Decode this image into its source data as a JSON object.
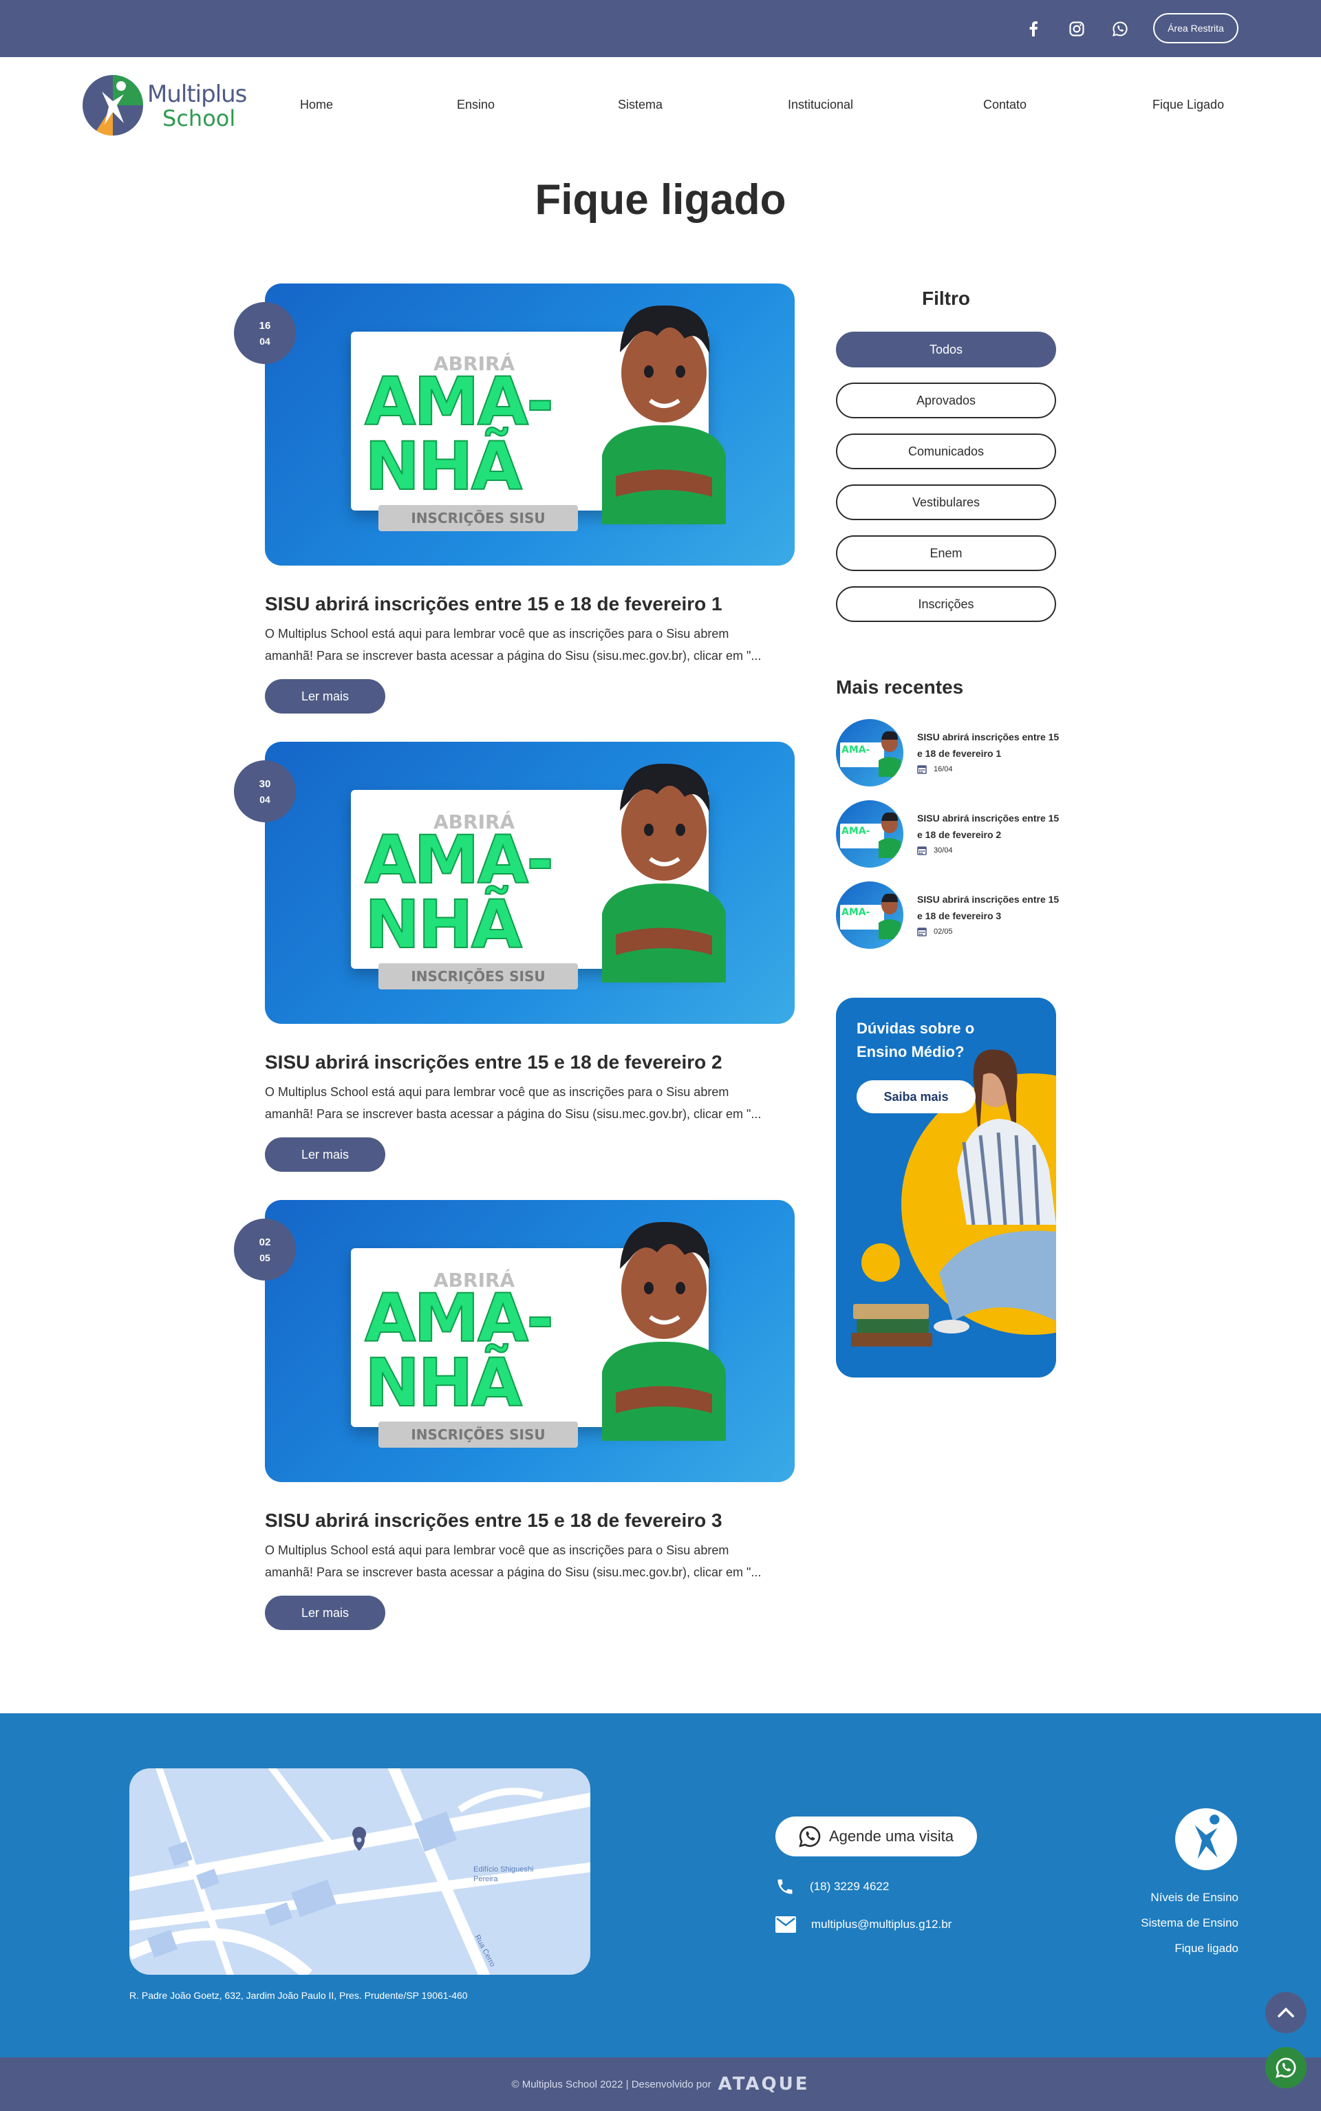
{
  "topbar": {
    "area_label": "Área Restrita",
    "icons": [
      "facebook-icon",
      "instagram-icon",
      "whatsapp-icon"
    ]
  },
  "brand": {
    "line1": "Multiplus",
    "line2": "School"
  },
  "nav": {
    "items": [
      {
        "label": "Home"
      },
      {
        "label": "Ensino"
      },
      {
        "label": "Sistema"
      },
      {
        "label": "Institucional"
      },
      {
        "label": "Contato"
      },
      {
        "label": "Fique Ligado"
      }
    ]
  },
  "page": {
    "title": "Fique ligado"
  },
  "banner_art": {
    "line_top": "ABRIRÁ",
    "line_1": "AMA-",
    "line_2": "NHÃ",
    "tag": "INSCRIÇÕES SISU"
  },
  "posts": [
    {
      "day": "16",
      "month": "04",
      "title": "SISU abrirá inscrições entre 15 e 18 de fevereiro 1",
      "excerpt": "O Multiplus School está aqui para lembrar você que as inscrições para o Sisu abrem amanhã! Para se inscrever basta acessar a página do Sisu (sisu.mec.gov.br), clicar em \"...",
      "more_label": "Ler mais"
    },
    {
      "day": "30",
      "month": "04",
      "title": "SISU abrirá inscrições entre 15 e 18 de fevereiro 2",
      "excerpt": "O Multiplus School está aqui para lembrar você que as inscrições para o Sisu abrem amanhã! Para se inscrever basta acessar a página do Sisu (sisu.mec.gov.br), clicar em \"...",
      "more_label": "Ler mais"
    },
    {
      "day": "02",
      "month": "05",
      "title": "SISU abrirá inscrições entre 15 e 18 de fevereiro 3",
      "excerpt": "O Multiplus School está aqui para lembrar você que as inscrições para o Sisu abrem amanhã! Para se inscrever basta acessar a página do Sisu (sisu.mec.gov.br), clicar em \"...",
      "more_label": "Ler mais"
    }
  ],
  "sidebar": {
    "filter_title": "Filtro",
    "filters": [
      {
        "label": "Todos",
        "active": true
      },
      {
        "label": "Aprovados",
        "active": false
      },
      {
        "label": "Comunicados",
        "active": false
      },
      {
        "label": "Vestibulares",
        "active": false
      },
      {
        "label": "Enem",
        "active": false
      },
      {
        "label": "Inscrições",
        "active": false
      }
    ],
    "recent_title": "Mais recentes",
    "recent": [
      {
        "title": "SISU abrirá inscrições entre 15 e 18 de fevereiro 1",
        "date": "16/04"
      },
      {
        "title": "SISU abrirá inscrições entre 15 e 18 de fevereiro 2",
        "date": "30/04"
      },
      {
        "title": "SISU abrirá inscrições entre 15 e 18 de fevereiro 3",
        "date": "02/05"
      }
    ],
    "promo": {
      "title": "Dúvidas sobre o Ensino Médio?",
      "button": "Saiba mais"
    }
  },
  "footer": {
    "address": "R. Padre João Goetz, 632, Jardim João Paulo II, Pres. Prudente/SP 19061-460",
    "map_labels": {
      "building": "Edifício Shigueshi Pereira",
      "street": "Rua Cerro"
    },
    "visit_label": "Agende uma visita",
    "phone": "(18) 3229 4622",
    "email": "multiplus@multiplus.g12.br",
    "links": [
      {
        "label": "Níveis de Ensino"
      },
      {
        "label": "Sistema de Ensino"
      },
      {
        "label": "Fique ligado"
      }
    ],
    "copyright": "© Multiplus School 2022 | Desenvolvido por",
    "dev_brand": "ATAQUE"
  },
  "colors": {
    "primary": "#4f5b86",
    "footer_blue": "#1f7cbf",
    "accent_green": "#22e07a",
    "promo_blue": "#1372c4"
  }
}
